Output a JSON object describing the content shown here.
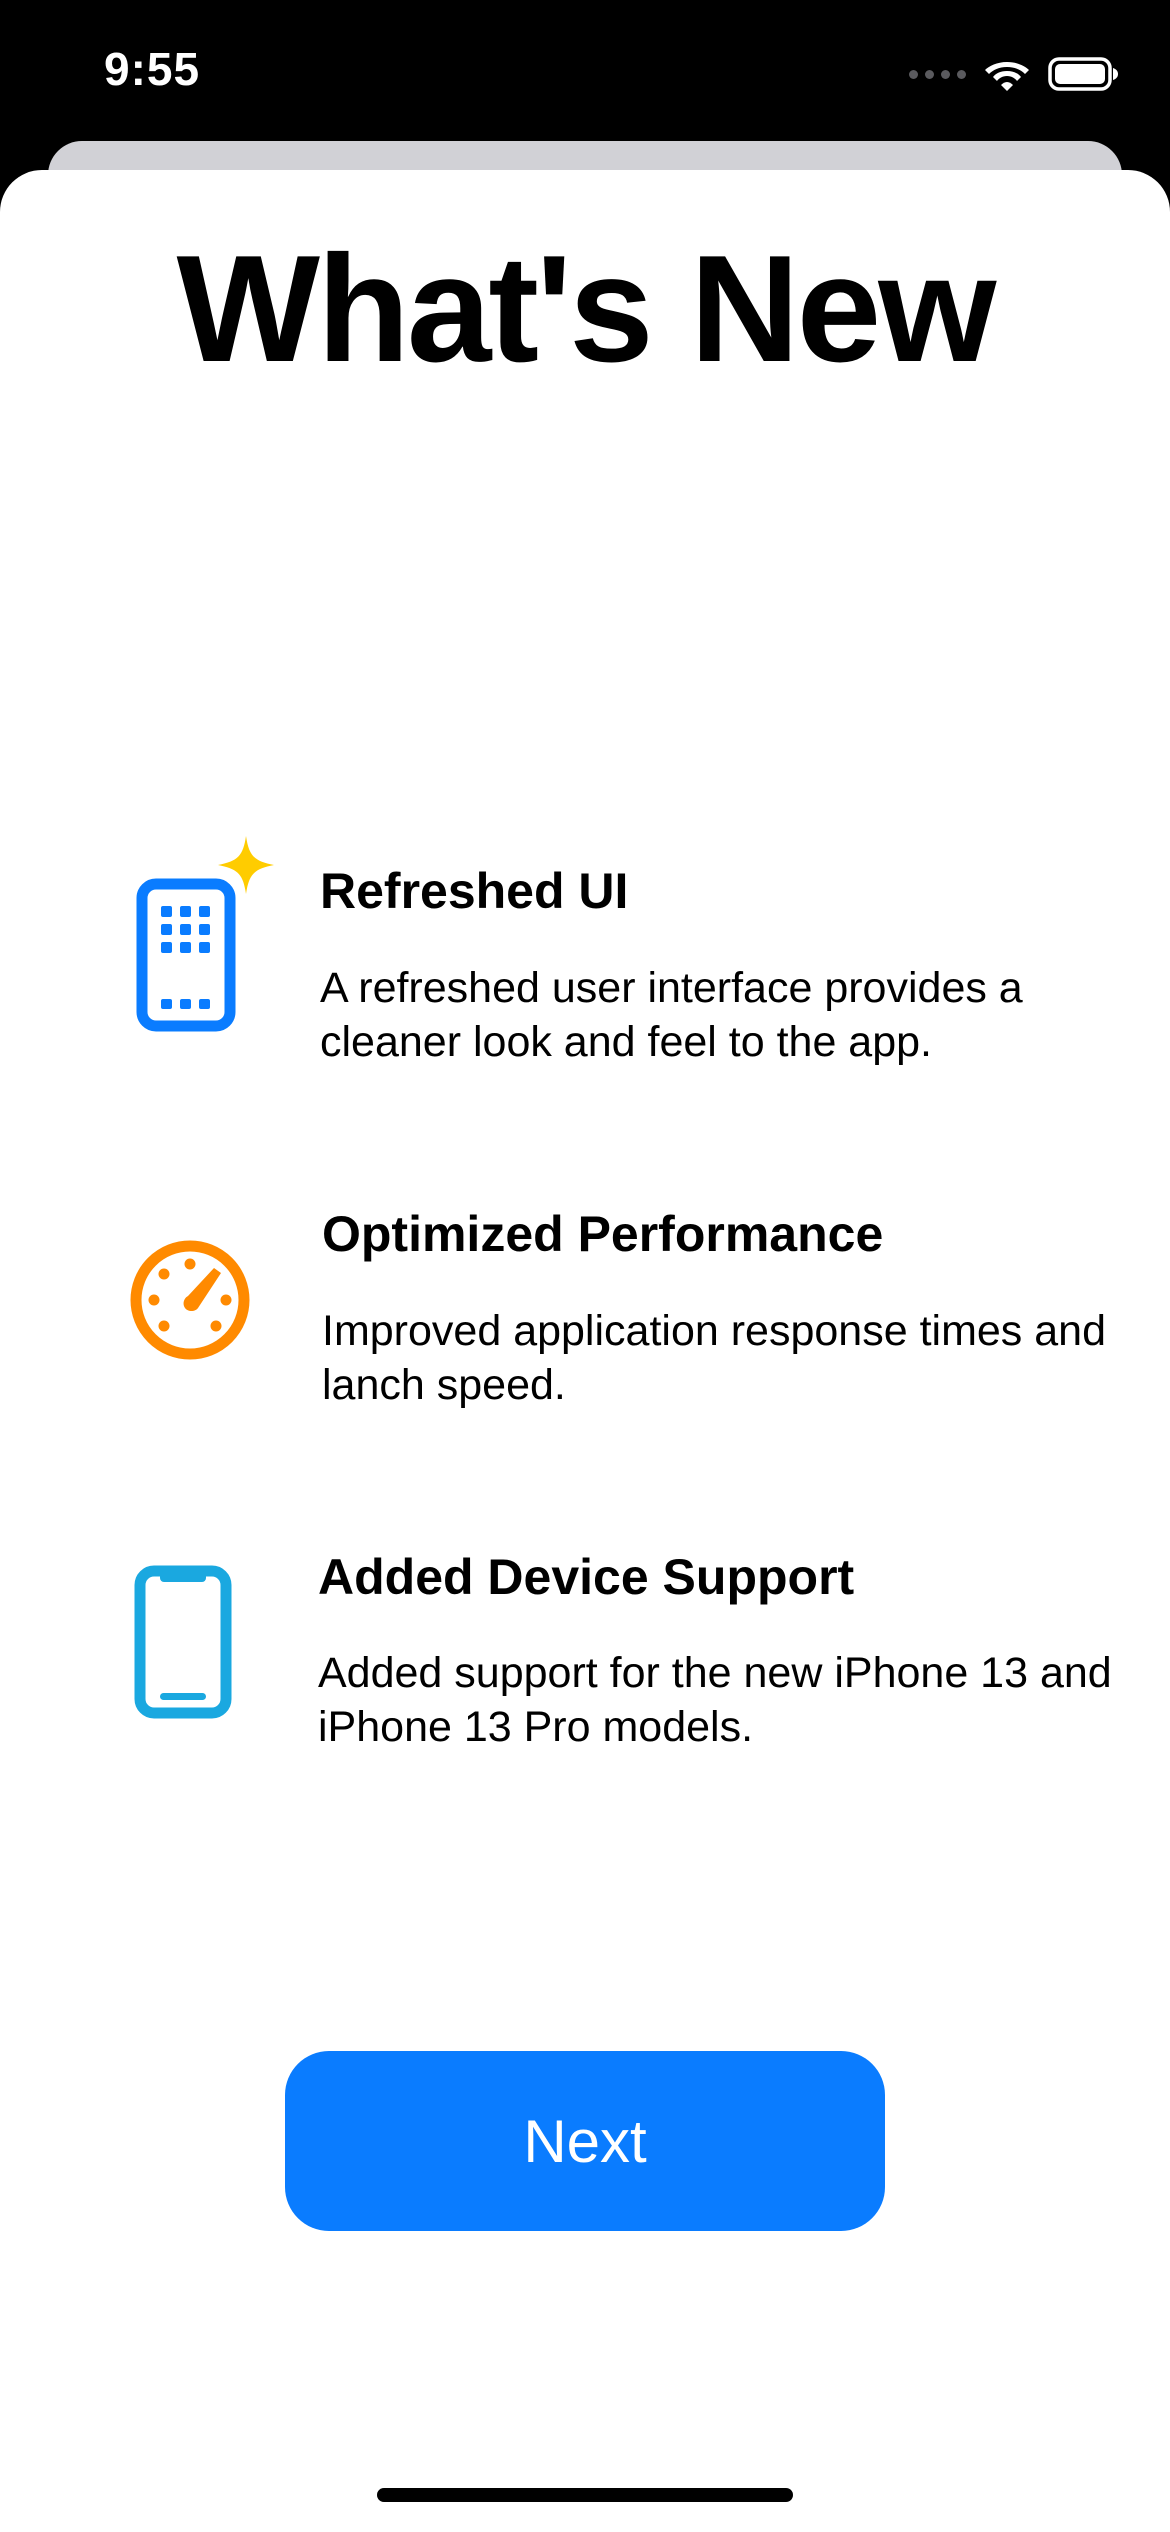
{
  "status_bar": {
    "time": "9:55",
    "icons": [
      "signal-dots-icon",
      "wifi-icon",
      "battery-icon"
    ]
  },
  "title": "What's New",
  "features": [
    {
      "icon": "iphone-app-grid-sparkle-icon",
      "icon_color": "#0a7cff",
      "sparkle_color": "#ffcc00",
      "title": "Refreshed UI",
      "description": "A refreshed user interface provides a cleaner look and feel to the app."
    },
    {
      "icon": "speedometer-icon",
      "icon_color": "#ff8a00",
      "title": "Optimized Performance",
      "description": "Improved application response times and lanch speed."
    },
    {
      "icon": "iphone-icon",
      "icon_color": "#1aa8e0",
      "title": "Added Device Support",
      "description": "Added support for the new iPhone 13 and iPhone 13 Pro models."
    }
  ],
  "next_button": {
    "label": "Next",
    "color": "#0a7cff"
  }
}
